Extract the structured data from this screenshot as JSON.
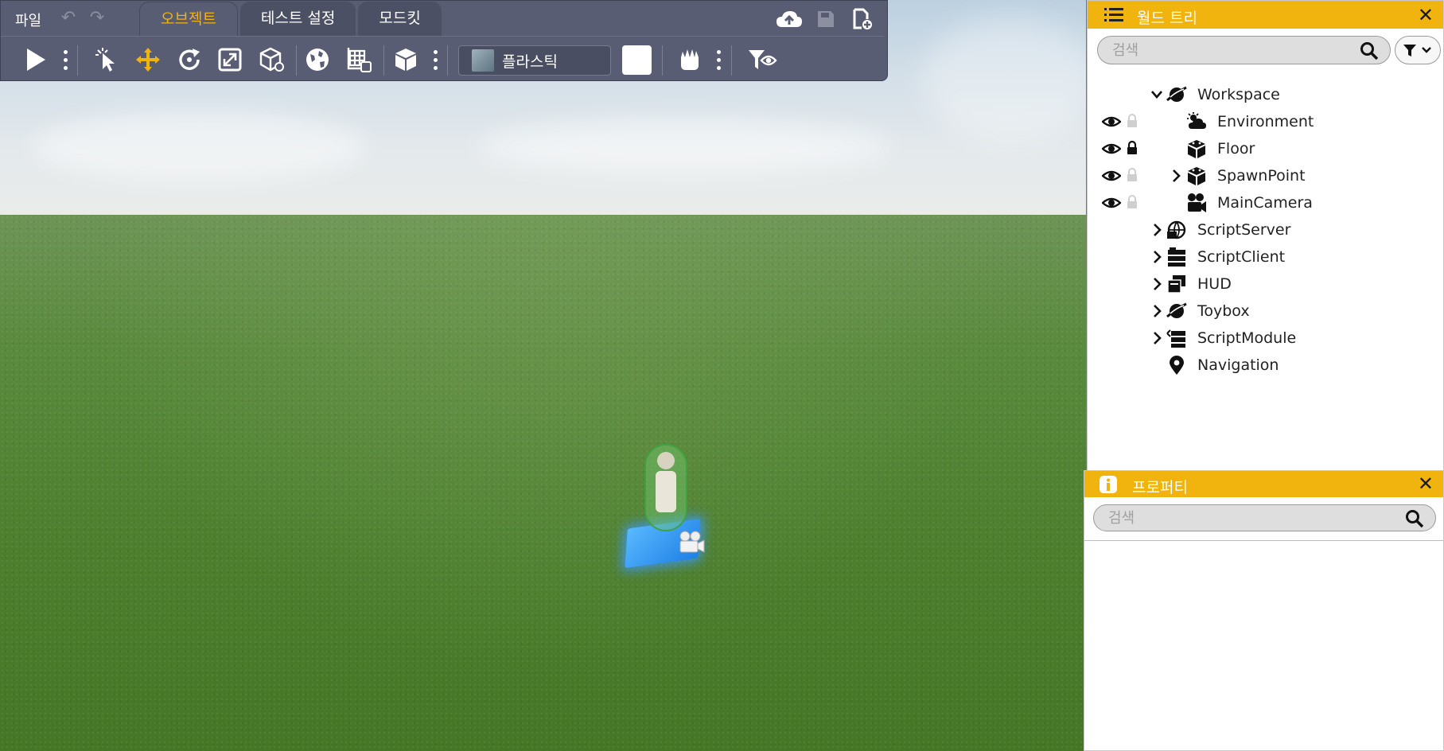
{
  "menu": {
    "file": "파일",
    "tabs": [
      {
        "label": "오브젝트",
        "active": true
      },
      {
        "label": "테스트 설정",
        "active": false
      },
      {
        "label": "모드킷",
        "active": false
      }
    ]
  },
  "toolbar": {
    "material": "플라스틱",
    "color": "#ffffff"
  },
  "world_tree": {
    "title": "월드 트리",
    "search_placeholder": "검색",
    "nodes": [
      {
        "label": "Workspace",
        "expanded": true,
        "icon": "workspace-icon"
      },
      {
        "label": "Environment",
        "icon": "environment-icon",
        "visible": true,
        "locked": false
      },
      {
        "label": "Floor",
        "icon": "floor-icon",
        "visible": true,
        "locked": true
      },
      {
        "label": "SpawnPoint",
        "icon": "spawnpoint-icon",
        "visible": true,
        "locked": false,
        "expanded": false
      },
      {
        "label": "MainCamera",
        "icon": "camera-icon",
        "visible": true,
        "locked": false
      },
      {
        "label": "ScriptServer",
        "icon": "script-server-icon",
        "expanded": false
      },
      {
        "label": "ScriptClient",
        "icon": "script-client-icon",
        "expanded": false
      },
      {
        "label": "HUD",
        "icon": "hud-icon",
        "expanded": false
      },
      {
        "label": "Toybox",
        "icon": "toybox-icon",
        "expanded": false
      },
      {
        "label": "ScriptModule",
        "icon": "script-module-icon",
        "expanded": false
      },
      {
        "label": "Navigation",
        "icon": "navigation-icon"
      }
    ]
  },
  "properties": {
    "title": "프로퍼티",
    "search_placeholder": "검색"
  },
  "colors": {
    "accent": "#f1b30e",
    "toolbar_bg": "#595d74",
    "move_tool": "#f1b30e"
  }
}
